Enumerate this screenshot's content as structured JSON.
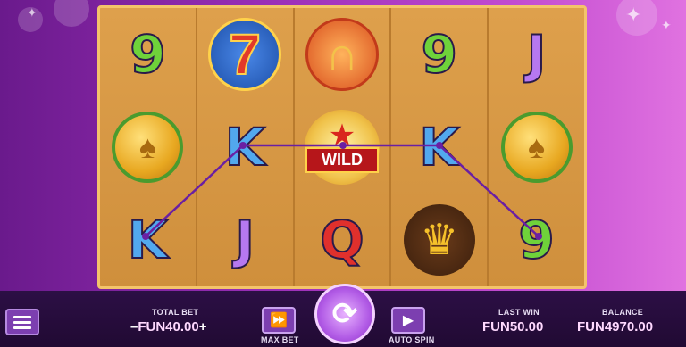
{
  "reels": [
    [
      {
        "type": "text",
        "glyph": "9",
        "cls": "g",
        "icon": "nine-green-icon"
      },
      {
        "type": "coin",
        "glyph": "♠",
        "icon": "spade-coin-icon"
      },
      {
        "type": "text",
        "glyph": "K",
        "cls": "b",
        "icon": "k-blue-icon"
      }
    ],
    [
      {
        "type": "seven",
        "glyph": "7",
        "icon": "lucky-seven-icon"
      },
      {
        "type": "text",
        "glyph": "K",
        "cls": "b",
        "icon": "k-blue-icon"
      },
      {
        "type": "text",
        "glyph": "J",
        "cls": "p",
        "icon": "j-purple-icon"
      }
    ],
    [
      {
        "type": "horse",
        "glyph": "∩",
        "icon": "horseshoe-icon"
      },
      {
        "type": "wild",
        "glyph": "★",
        "label": "WILD",
        "icon": "wild-star-icon"
      },
      {
        "type": "text",
        "glyph": "Q",
        "cls": "r",
        "icon": "q-red-icon"
      }
    ],
    [
      {
        "type": "text",
        "glyph": "9",
        "cls": "g",
        "icon": "nine-green-icon"
      },
      {
        "type": "text",
        "glyph": "K",
        "cls": "b",
        "icon": "k-blue-icon"
      },
      {
        "type": "crown",
        "glyph": "♛",
        "icon": "crown-icon"
      }
    ],
    [
      {
        "type": "text",
        "glyph": "J",
        "cls": "p",
        "icon": "j-purple-icon"
      },
      {
        "type": "coin",
        "glyph": "♠",
        "icon": "spade-coin-icon"
      },
      {
        "type": "text",
        "glyph": "9",
        "cls": "g",
        "icon": "nine-green-icon"
      }
    ]
  ],
  "payline": {
    "color": "#6a1fa3"
  },
  "controls": {
    "total_bet_label": "TOTAL BET",
    "total_bet_value": "FUN40.00",
    "minus": "–",
    "plus": "+",
    "max_bet_label": "MAX BET",
    "auto_spin_label": "AUTO SPIN",
    "last_win_label": "LAST WIN",
    "last_win_value": "FUN50.00",
    "balance_label": "BALANCE",
    "balance_value": "FUN4970.00",
    "spin_glyph": "⟳",
    "max_bet_glyph": "⏩",
    "auto_spin_glyph": "▶"
  }
}
